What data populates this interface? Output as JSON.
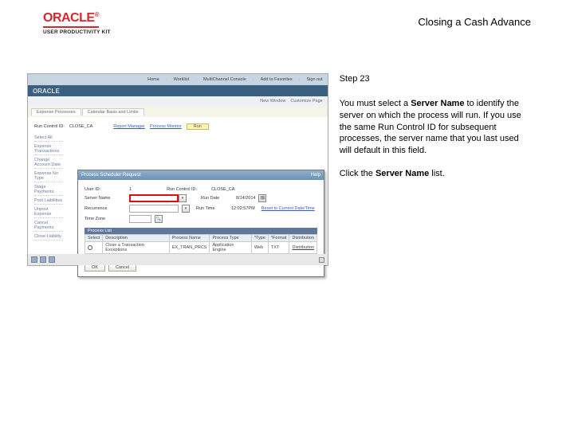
{
  "header": {
    "brand": "ORACLE",
    "brand_reg": "®",
    "upk": "USER PRODUCTIVITY KIT",
    "doc_title": "Closing a Cash Advance"
  },
  "app": {
    "top_links": [
      "Home",
      "Worklist",
      "MultiChannel Console",
      "Add to Favorites",
      "Sign out"
    ],
    "brand": "ORACLE",
    "sublinks": [
      "New Window",
      "Customize Page"
    ],
    "tabs": [
      "Expense Processes",
      "Calendar Basis and Limits"
    ],
    "run_control_label": "Run Control ID:",
    "run_control_value": "CLOSE_CA",
    "report_mgr": "Report Manager",
    "process_mon": "Process Monitor",
    "run_btn": "Run",
    "side_rows": [
      "Select All",
      "Expense Transactions",
      "Change Account Date",
      "Expense No Type",
      "Stage Payments",
      "Post Liabilities",
      "Unpost Expense",
      "Cancel Payments",
      "Close Liability"
    ],
    "modal": {
      "title": "Process Scheduler Request",
      "help": "Help",
      "user_label": "User ID:",
      "user_value": "1",
      "run_ctrl_label": "Run Control ID:",
      "run_ctrl_value": "CLOSE_CA",
      "server_label": "Server Name",
      "run_date_label": "Run Date",
      "run_date_value": "8/14/2014",
      "recur_label": "Recurrence",
      "run_time_label": "Run Time",
      "run_time_value": "12:02:57PM",
      "reset_link": "Reset to Current Date/Time",
      "tz_label": "Time Zone",
      "list_hdr": "Process List",
      "th": [
        "Select",
        "Description",
        "Process Name",
        "Process Type",
        "*Type",
        "*Format",
        "Distribution"
      ],
      "row": [
        "",
        "Close a Transaction Exceptions",
        "EX_TRAN_PRCS",
        "Application Engine",
        "Web",
        "TXT",
        "Distribution"
      ],
      "ok": "OK",
      "cancel": "Cancel"
    },
    "footer_icons": 3
  },
  "instr": {
    "step": "Step 23",
    "p1a": "You must select a ",
    "p1b": "Server Name",
    "p1c": " to identify the server on which the process will run. If you use the same Run Control ID for subsequent processes, the server name that you last used will default in this field.",
    "p2a": "Click the ",
    "p2b": "Server Name",
    "p2c": " list."
  }
}
